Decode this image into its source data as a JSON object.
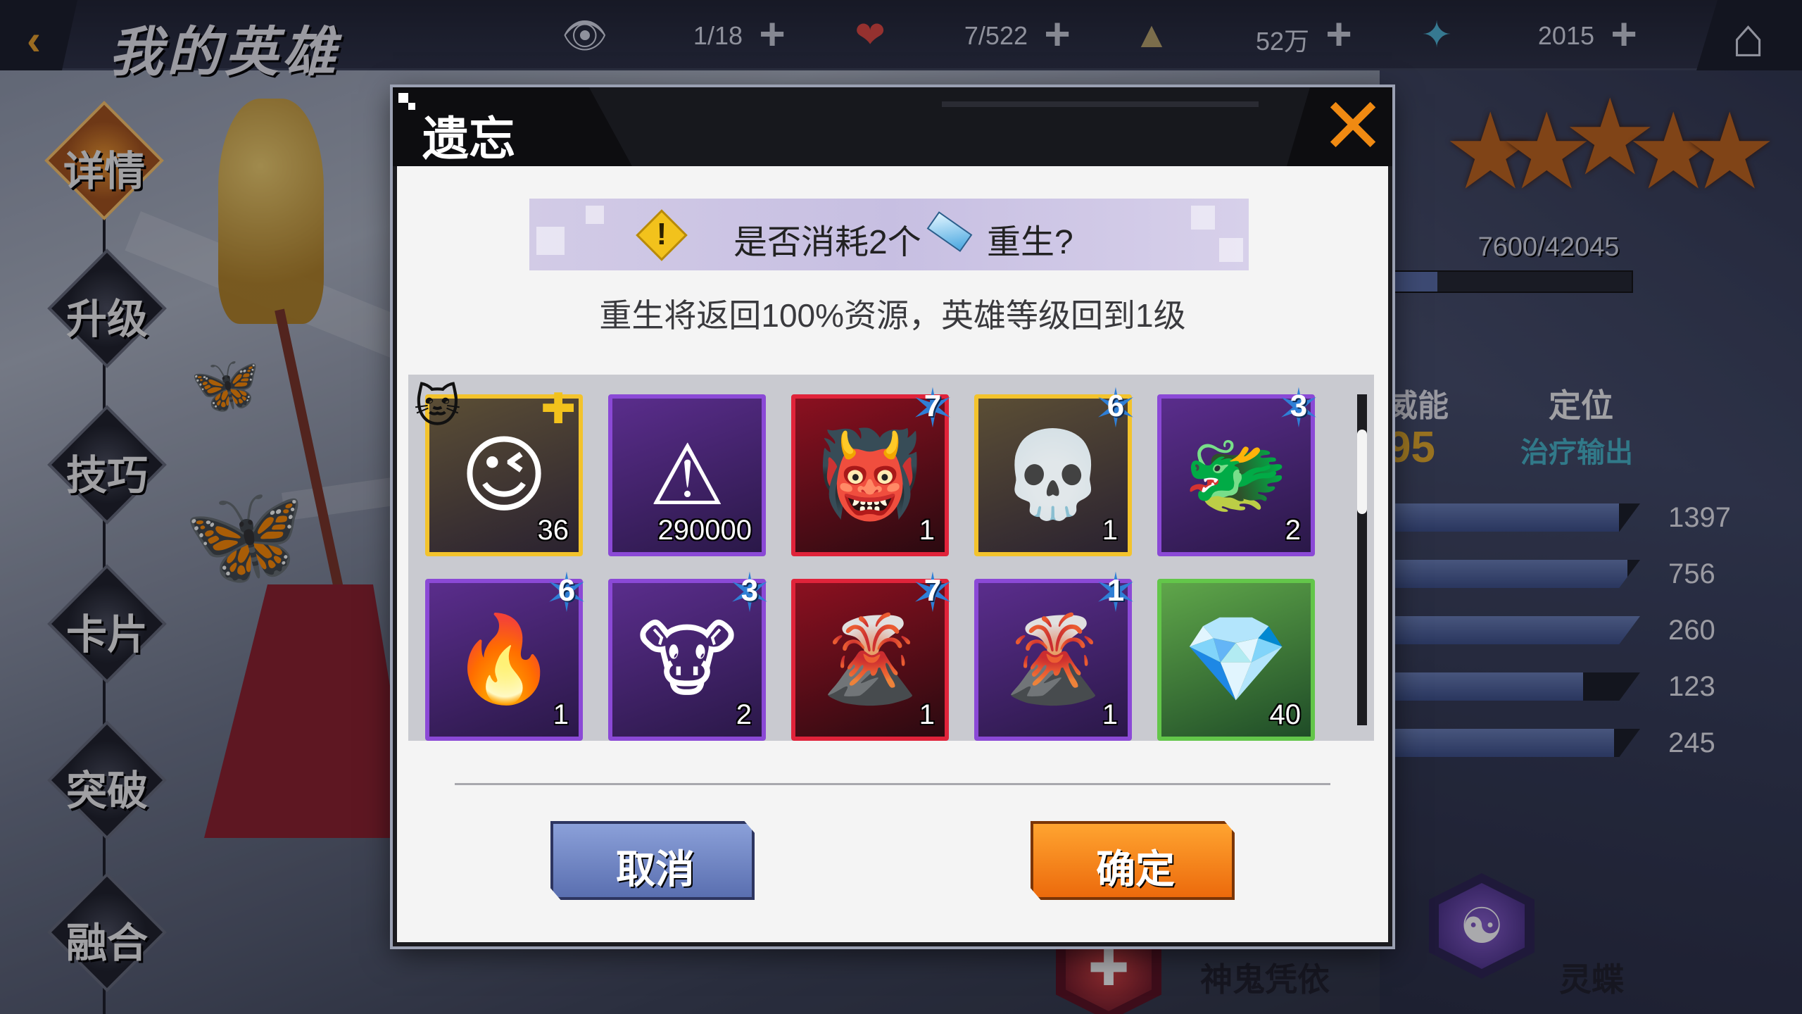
{
  "header": {
    "title": "我的英雄",
    "resources": [
      {
        "icon": "eye-icon",
        "glyph": "👁",
        "value": "1/18",
        "color": "#d8dbe6"
      },
      {
        "icon": "heart-icon",
        "glyph": "❤",
        "value": "7/522",
        "color": "#e0483f"
      },
      {
        "icon": "triangle-circuit-icon",
        "glyph": "▲",
        "value": "52万",
        "color": "#b8a46a"
      },
      {
        "icon": "star-crystal-icon",
        "glyph": "✦",
        "value": "2015",
        "color": "#4fb6d6"
      }
    ],
    "plus_glyph": "+",
    "back_glyph": "‹",
    "home_glyph": "⌂"
  },
  "side_menu": [
    {
      "label": "详情",
      "active": true
    },
    {
      "label": "升级",
      "active": false
    },
    {
      "label": "技巧",
      "active": false
    },
    {
      "label": "卡片",
      "active": false
    },
    {
      "label": "突破",
      "active": false
    },
    {
      "label": "融合",
      "active": false
    }
  ],
  "hero_panel": {
    "stars": 5,
    "exp_text": "7600/42045",
    "exp_fraction": 0.18,
    "power_label": "威能",
    "power_value": "95",
    "role_label": "定位",
    "role_value": "治疗输出",
    "stats": [
      {
        "value": "1397",
        "fill": 0.92
      },
      {
        "value": "756",
        "fill": 0.95
      },
      {
        "value": "260",
        "fill": 1.0
      },
      {
        "value": "123",
        "fill": 0.78
      },
      {
        "value": "245",
        "fill": 0.9
      }
    ],
    "skills": [
      {
        "name": "神鬼凭依",
        "icon": "demon-mask-icon"
      },
      {
        "name": "灵蝶",
        "icon": "yin-yang-icon"
      }
    ]
  },
  "dialog": {
    "title": "遗忘",
    "close_glyph": "✕",
    "prompt_part1": "是否消耗2个",
    "prompt_part2": "重生?",
    "warn_glyph": "!",
    "info": "重生将返回100%资源，英雄等级回到1级",
    "items": [
      {
        "rarity": "gold",
        "art": "hero-portrait",
        "glyph": "😉",
        "qty": "36",
        "badge": null,
        "extra": "cat-puzzle"
      },
      {
        "rarity": "purple",
        "art": "circuit-triangle",
        "glyph": "⚠",
        "qty": "290000",
        "badge": null
      },
      {
        "rarity": "red",
        "art": "shadow-demon",
        "glyph": "👹",
        "qty": "1",
        "badge": "7"
      },
      {
        "rarity": "gold",
        "art": "skull-dragon",
        "glyph": "💀",
        "qty": "1",
        "badge": "6"
      },
      {
        "rarity": "purple",
        "art": "red-dragon",
        "glyph": "🐲",
        "qty": "2",
        "badge": "3"
      },
      {
        "rarity": "purple",
        "art": "flame-beast",
        "glyph": "🔥",
        "qty": "1",
        "badge": "6"
      },
      {
        "rarity": "purple",
        "art": "horned-demon",
        "glyph": "🐮",
        "qty": "2",
        "badge": "3"
      },
      {
        "rarity": "red",
        "art": "lava-dragon",
        "glyph": "🌋",
        "qty": "1",
        "badge": "7"
      },
      {
        "rarity": "purple",
        "art": "lava-dragon",
        "glyph": "🌋",
        "qty": "1",
        "badge": "1"
      },
      {
        "rarity": "green",
        "art": "crystal-chip",
        "glyph": "💎",
        "qty": "40",
        "badge": null
      }
    ],
    "cancel_label": "取消",
    "confirm_label": "确定"
  }
}
